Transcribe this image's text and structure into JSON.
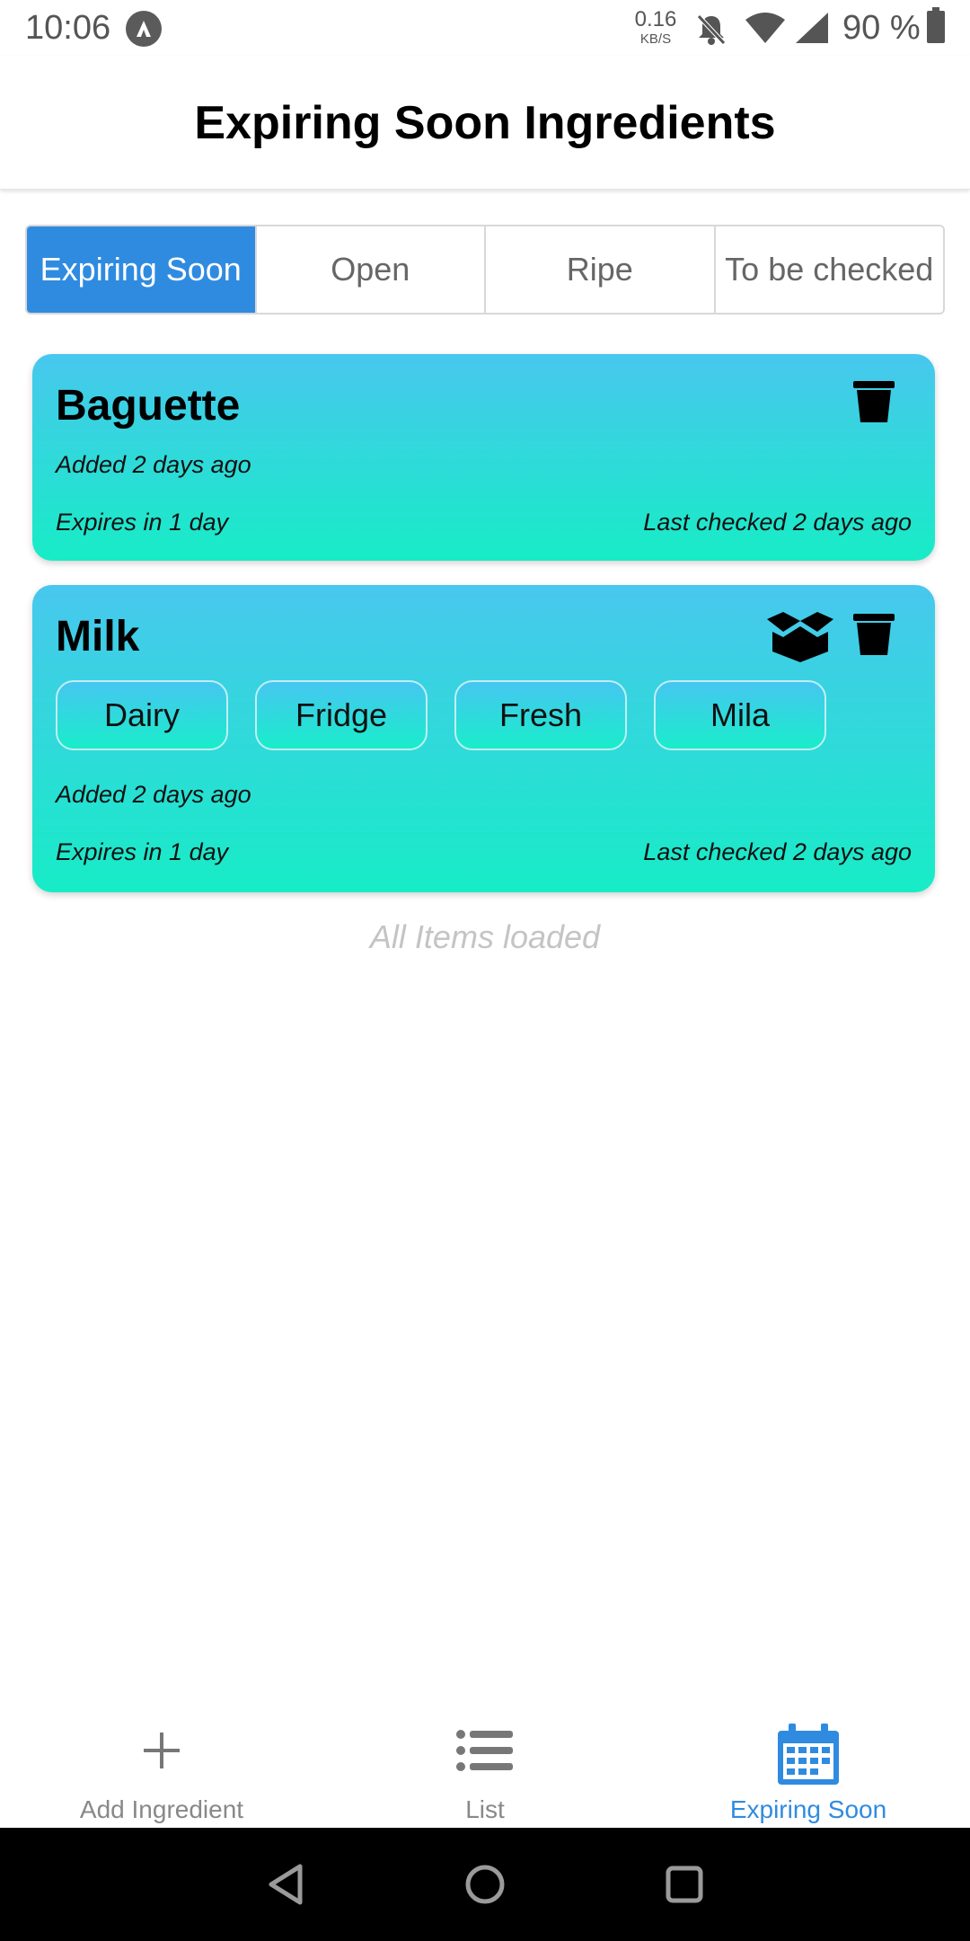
{
  "status_bar": {
    "time": "10:06",
    "net_speed": "0.16",
    "net_unit": "KB/S",
    "battery": "90 %"
  },
  "header": {
    "title": "Expiring Soon Ingredients"
  },
  "tabs": [
    {
      "label": "Expiring Soon",
      "active": true
    },
    {
      "label": "Open",
      "active": false
    },
    {
      "label": "Ripe",
      "active": false
    },
    {
      "label": "To be checked",
      "active": false
    }
  ],
  "cards": [
    {
      "name": "Baguette",
      "added": "Added 2 days ago",
      "expires": "Expires in 1 day",
      "last_checked": "Last checked 2 days ago",
      "tags": []
    },
    {
      "name": "Milk",
      "tags": [
        "Dairy",
        "Fridge",
        "Fresh",
        "Mila"
      ],
      "added": "Added 2 days ago",
      "expires": "Expires in 1 day",
      "last_checked": "Last checked 2 days ago"
    }
  ],
  "footer_note": "All Items loaded",
  "bottom_nav": [
    {
      "label": "Add Ingredient",
      "icon": "plus-icon",
      "active": false
    },
    {
      "label": "List",
      "icon": "list-icon",
      "active": false
    },
    {
      "label": "Expiring Soon",
      "icon": "calendar-icon",
      "active": true
    }
  ],
  "colors": {
    "accent": "#2f8be0",
    "card_gradient_top": "#48c7ee",
    "card_gradient_bottom": "#17ecc6"
  }
}
